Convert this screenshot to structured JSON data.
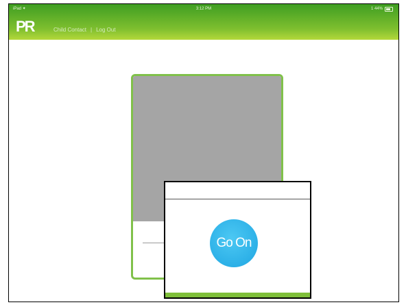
{
  "status_bar": {
    "carrier": "iPad ✦",
    "time": "3:12 PM",
    "battery": "1 44%"
  },
  "header": {
    "logo": "PR",
    "nav": {
      "item1": "Child Contact",
      "separator": "|",
      "item2": "Log Out"
    }
  },
  "zoom": {
    "button_label": "Go On"
  },
  "colors": {
    "brand_green": "#7fbf3a",
    "button_blue": "#1fa6e2",
    "image_placeholder": "#a5a5a5"
  }
}
